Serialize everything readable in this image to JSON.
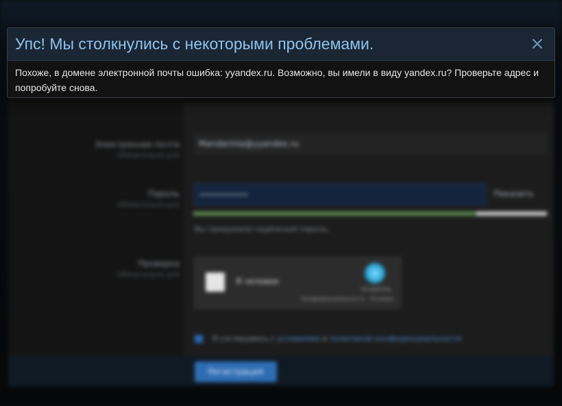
{
  "dialog": {
    "title": "Упс! Мы столкнулись с некоторыми проблемами.",
    "close_icon": "×",
    "message": "Похоже, в домене электронной почты ошибка: yyandex.ru. Возможно, вы имели в виду yandex.ru? Проверьте адрес и попробуйте снова."
  },
  "form": {
    "email_label": "Электронная почта",
    "email_required": "Обязательно для",
    "email_value": "Mandarinla@yyandex.ru",
    "password_label": "Пароль",
    "password_required": "Обязательно для",
    "password_value": "••••••••••",
    "show_password_label": "Показать",
    "password_strength": 0.8,
    "password_hint": "Вы придумали надёжный пароль.",
    "captcha_label": "Проверка",
    "captcha_required": "Обязательно для",
    "captcha_text": "Я человек",
    "captcha_brand": "hCaptcha",
    "captcha_links": "Конфиденциальность · Условия",
    "terms_prefix": "Я соглашаюсь с",
    "terms_link1": "условиями",
    "terms_and": "и",
    "terms_link2": "политикой конфиденциальности",
    "submit_label": "Регистрация"
  },
  "colors": {
    "dialog_title": "#8ec3f0",
    "dialog_header_bg": "#1a2633",
    "accent": "#2e6db3"
  }
}
